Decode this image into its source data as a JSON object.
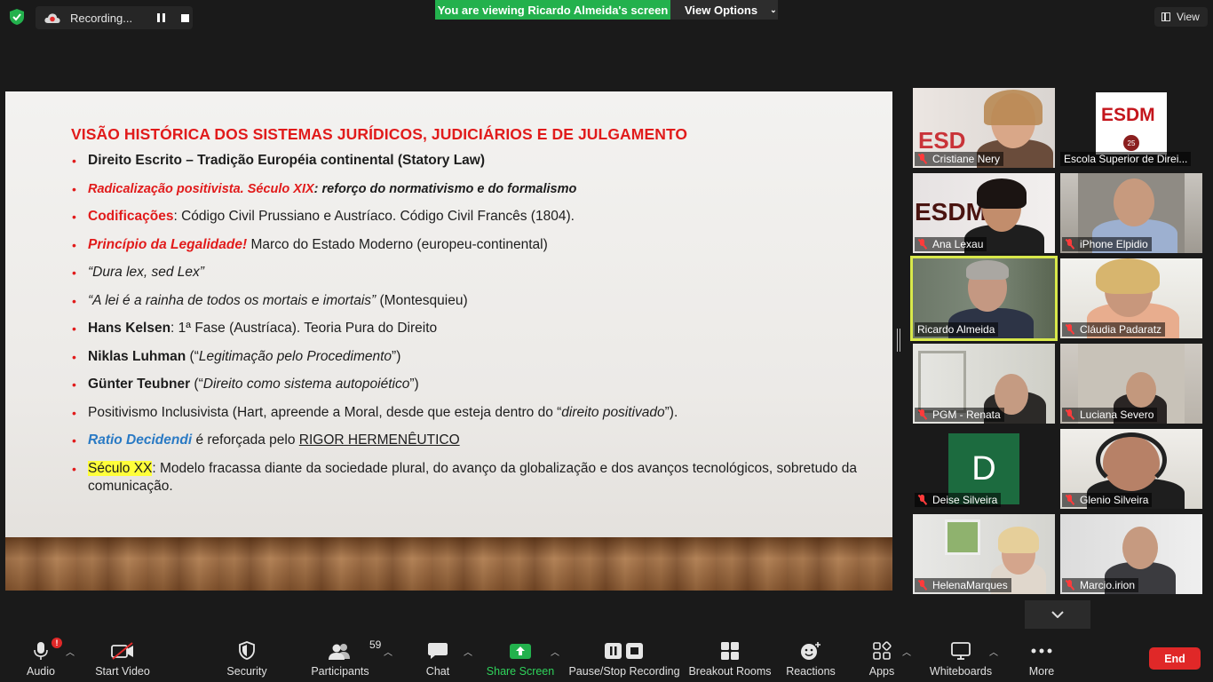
{
  "topbar": {
    "recording_label": "Recording...",
    "viewing_banner": "You are viewing Ricardo Almeida's screen",
    "view_options_label": "View Options",
    "view_label": "View"
  },
  "slide": {
    "title": "VISÃO HISTÓRICA DOS SISTEMAS JURÍDICOS, JUDICIÁRIOS E DE JULGAMENTO",
    "b1": "Direito Escrito – Tradição Européia continental (Statory Law)",
    "b2a": "Radicalização positivista. Século XIX",
    "b2b": ": reforço do normativismo e do formalismo",
    "b3a": "Codificações",
    "b3b": ": Código Civil Prussiano e Austríaco. Código Civil Francês (1804).",
    "b4a": "Princípio da Legalidade!",
    "b4b": " Marco do Estado Moderno (europeu-continental)",
    "b5": "“Dura lex, sed Lex”",
    "b6a": "“A lei é a rainha de todos os mortais e imortais”",
    "b6b": " (Montesquieu)",
    "b7a": "Hans Kelsen",
    "b7b": ": 1ª Fase (Austríaca). Teoria Pura do Direito",
    "b8a": "Niklas Luhman",
    "b8b": " (“",
    "b8c": "Legitimação pelo Procedimento",
    "b8d": "”)",
    "b9a": "Günter Teubner",
    "b9b": " (“",
    "b9c": "Direito como sistema autopoiético",
    "b9d": "”)",
    "b10a": "Positivismo Inclusivista (Hart, apreende a Moral, desde que esteja dentro do “",
    "b10b": "direito positivado",
    "b10c": "”).",
    "b11a": "Ratio Decidendi",
    "b11b": " é reforçada pelo ",
    "b11c": "RIGOR HERMENÊUTICO",
    "b12a": "Século XX",
    "b12b": ": Modelo fracassa diante da sociedade plural, do avanço da globalização e dos avanços tecnológicos, sobretudo da comunicação."
  },
  "participants_tiles": [
    {
      "name": "Cristiane Nery"
    },
    {
      "name": "Escola Superior de Direi..."
    },
    {
      "name": "Ana Lexau"
    },
    {
      "name": "iPhone Elpidio"
    },
    {
      "name": "Ricardo Almeida"
    },
    {
      "name": "Cláudia Padaratz"
    },
    {
      "name": "PGM - Renata"
    },
    {
      "name": "Luciana Severo"
    },
    {
      "name": "Deise Silveira",
      "initial": "D"
    },
    {
      "name": "Glenio Silveira"
    },
    {
      "name": "HelenaMarques"
    },
    {
      "name": "Marcio.irion"
    }
  ],
  "esdm": {
    "logo": "ESDM",
    "badge": "25"
  },
  "toolbar": {
    "audio": "Audio",
    "start_video": "Start Video",
    "security": "Security",
    "participants": "Participants",
    "participants_count": "59",
    "chat": "Chat",
    "share_screen": "Share Screen",
    "pause_stop": "Pause/Stop Recording",
    "breakout": "Breakout Rooms",
    "reactions": "Reactions",
    "apps": "Apps",
    "whiteboards": "Whiteboards",
    "more": "More",
    "end": "End",
    "audio_alert": "!"
  },
  "colors": {
    "accent_green": "#23b14d",
    "end_red": "#e02828",
    "slide_red": "#e11b1b",
    "active_speaker": "#d8e84a"
  }
}
